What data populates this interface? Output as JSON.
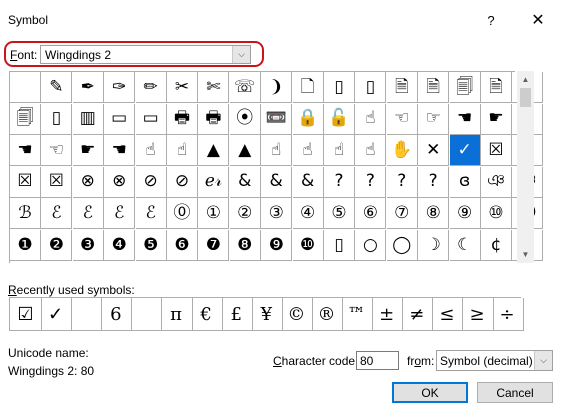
{
  "window": {
    "title": "Symbol",
    "help_glyph": "?",
    "close_glyph": "✕"
  },
  "font": {
    "label_underline": "F",
    "label_rest": "ont:",
    "value": "Wingdings 2",
    "arrow": "⌵"
  },
  "symbol_rows": [
    [
      "",
      "✎",
      "✒",
      "✑",
      "✏",
      "✂",
      "✄",
      "☏",
      "❩",
      "🗋",
      "▯",
      "▯",
      "🗎",
      "🗎",
      "🗐",
      "🗎",
      "▯"
    ],
    [
      "🗐",
      "▯",
      "▥",
      "▭",
      "▭",
      "🖶",
      "🖶",
      "⦿",
      "📼",
      "🔒",
      "🔓",
      "☝",
      "☜",
      "☞",
      "☚",
      "☛",
      "☛"
    ],
    [
      "☚",
      "☜",
      "☛",
      "☚",
      "☝",
      "☝",
      "▲",
      "▲",
      "☝",
      "☝",
      "☝",
      "☝",
      "✋",
      "✕",
      "✓",
      "☒",
      "☑"
    ],
    [
      "☒",
      "☒",
      "⊗",
      "⊗",
      "⊘",
      "⊘",
      "ℯ𝓇",
      "&",
      "&",
      "&",
      "?",
      "?",
      "?",
      "?",
      "ɞ",
      "ঞ",
      "ঞ"
    ],
    [
      "ℬ",
      "ℰ",
      "ℰ",
      "ℰ",
      "ℰ",
      "⓪",
      "①",
      "②",
      "③",
      "④",
      "⑤",
      "⑥",
      "⑦",
      "⑧",
      "⑨",
      "⑩",
      "⓿"
    ],
    [
      "❶",
      "❷",
      "❸",
      "❹",
      "❺",
      "❻",
      "❼",
      "❽",
      "❾",
      "❿",
      "▯",
      "○",
      "◯",
      "☽",
      "☾",
      "¢",
      "†"
    ]
  ],
  "selected_cell": {
    "row": 2,
    "col": 14
  },
  "scrollbar": {
    "up": "▲",
    "down": "▼"
  },
  "recent": {
    "label_underline": "R",
    "label_rest": "ecently used symbols:",
    "symbols": [
      "☑",
      "✓",
      "",
      "6",
      "",
      "π",
      "€",
      "£",
      "¥",
      "©",
      "®",
      "™",
      "±",
      "≠",
      "≤",
      "≥",
      "÷"
    ]
  },
  "unicode": {
    "label": "Unicode name:",
    "value": "Wingdings 2: 80"
  },
  "char_code": {
    "label_underline": "C",
    "label_rest": "haracter code:",
    "value": "80"
  },
  "from": {
    "label_pre": "fr",
    "label_underline": "o",
    "label_post": "m:",
    "value": "Symbol (decimal)",
    "arrow": "⌵"
  },
  "buttons": {
    "ok": "OK",
    "cancel": "Cancel"
  },
  "colors": {
    "selection": "#0a6fd6",
    "highlight_border": "#c8151c",
    "default_button_border": "#0078d7"
  }
}
